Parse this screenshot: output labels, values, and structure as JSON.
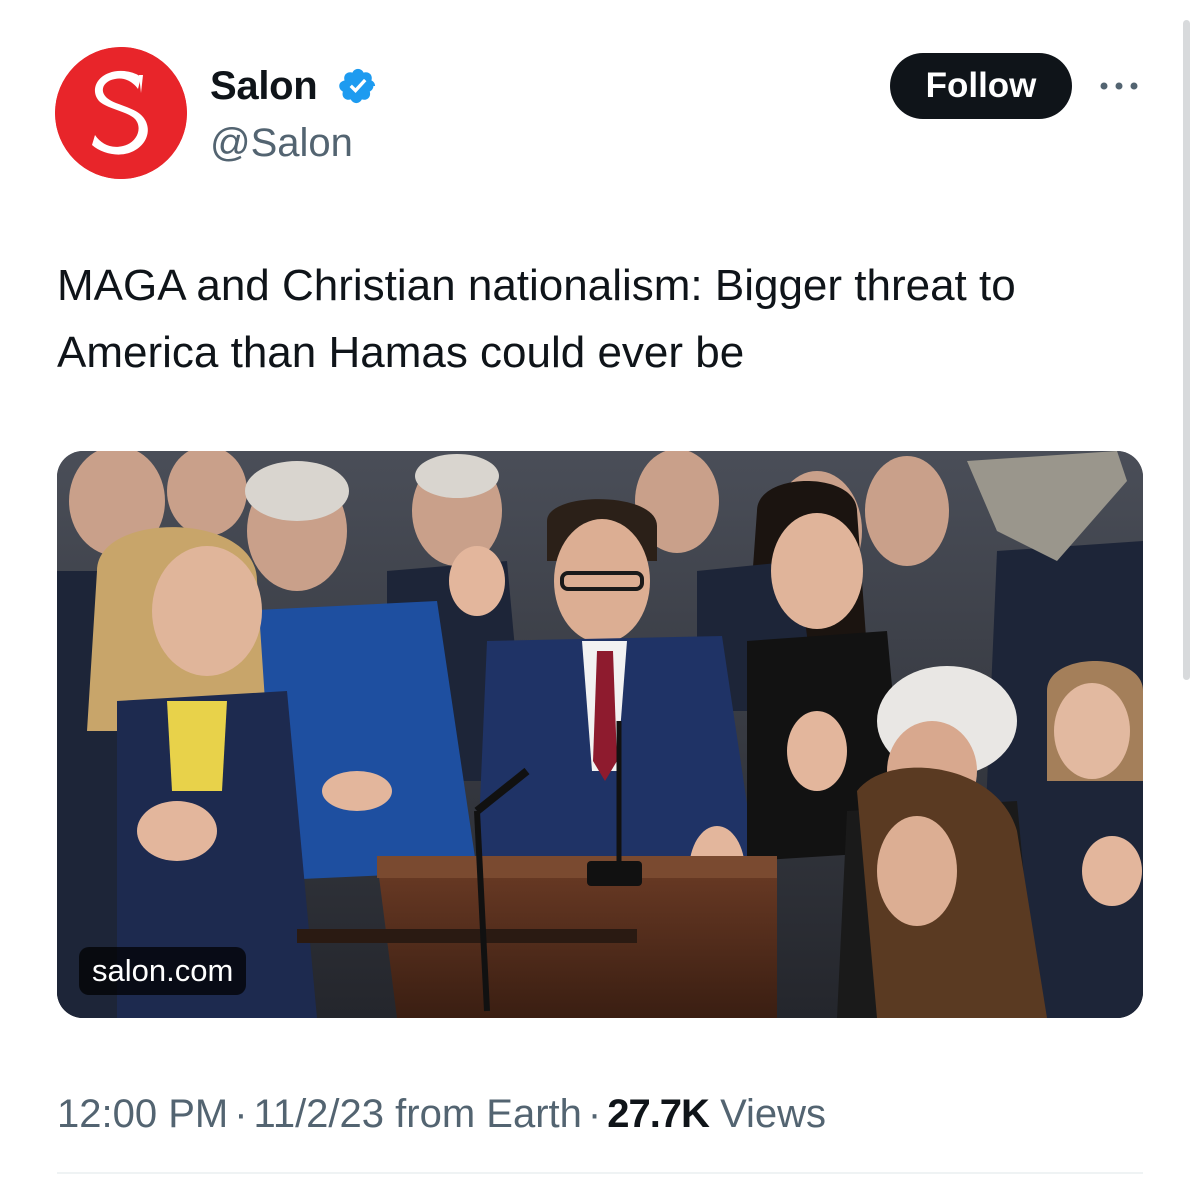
{
  "account": {
    "display_name": "Salon",
    "handle": "@Salon",
    "avatar_letter": "S",
    "avatar_color": "#e8252a",
    "verified_icon": "verified-badge-icon",
    "verified_color": "#1d9bf0"
  },
  "actions": {
    "follow_label": "Follow",
    "more_icon": "more-horizontal-icon"
  },
  "tweet": {
    "text": "MAGA and Christian nationalism: Bigger threat to America than Hamas could ever be"
  },
  "media": {
    "domain": "salon.com"
  },
  "meta": {
    "time": "12:00 PM",
    "separator": "·",
    "date": "11/2/23 from Earth",
    "views_count": "27.7K",
    "views_label": "Views"
  },
  "colors": {
    "text_primary": "#0f1419",
    "text_secondary": "#536471",
    "button_bg": "#0f1419"
  }
}
